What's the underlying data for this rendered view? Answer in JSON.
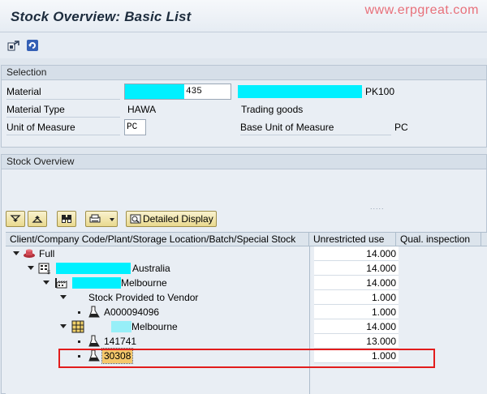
{
  "window": {
    "title": "Stock Overview: Basic List",
    "watermark": "www.erpgreat.com"
  },
  "toolbar": {
    "icons": [
      "selection-icon",
      "refresh-icon"
    ]
  },
  "selection": {
    "header": "Selection",
    "material_label": "Material",
    "material_value": "435",
    "material_desc": "PK100",
    "material_type_label": "Material Type",
    "material_type_value": "HAWA",
    "material_type_desc": "Trading goods",
    "uom_label": "Unit of Measure",
    "uom_value": "PC",
    "base_uom_label": "Base Unit of Measure",
    "base_uom_value": "PC"
  },
  "overview": {
    "header": "Stock Overview",
    "resize_handle": ".....",
    "buttons": {
      "expand_icon": "expand-all-icon",
      "collapse_icon": "collapse-all-icon",
      "find_icon": "binoculars-icon",
      "print_icon": "printer-icon",
      "detailed_display": "Detailed Display"
    },
    "columns": [
      "Client/Company Code/Plant/Storage Location/Batch/Special Stock",
      "Unrestricted use",
      "Qual. inspection"
    ],
    "rows": [
      {
        "text": "Full",
        "value": "14.000",
        "icon": "stock-icon"
      },
      {
        "text": "Australia",
        "value": "14.000",
        "icon": "company-code-icon"
      },
      {
        "text": "Melbourne",
        "value": "14.000",
        "icon": "plant-icon"
      },
      {
        "text": "Stock Provided to Vendor",
        "value": "1.000",
        "icon": ""
      },
      {
        "text": "A000094096",
        "value": "1.000",
        "icon": "batch-icon"
      },
      {
        "text": "Melbourne",
        "value": "14.000",
        "icon": "storage-location-icon"
      },
      {
        "text": "141741",
        "value": "13.000",
        "icon": "batch-icon"
      },
      {
        "text": "30308",
        "value": "1.000",
        "icon": "batch-icon"
      }
    ]
  },
  "colors": {
    "redaction": "#00f0ff",
    "highlight_box": "#e21c1c",
    "watermark": "#e8707a"
  }
}
